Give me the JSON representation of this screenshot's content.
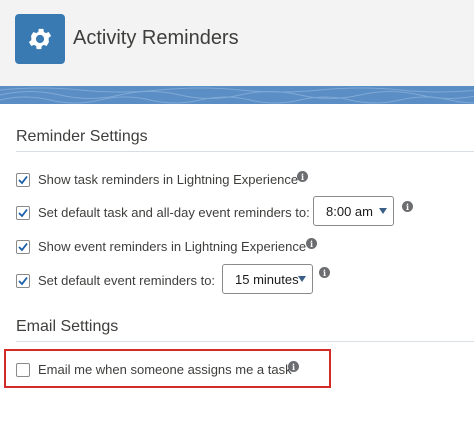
{
  "header": {
    "title": "Activity Reminders",
    "icon": "gear-icon",
    "icon_bg": "#3a7ab3"
  },
  "reminder_settings": {
    "title": "Reminder Settings",
    "items": [
      {
        "label": "Show task reminders in Lightning Experience",
        "checked": true
      },
      {
        "label": "Set default task and all-day event reminders to:",
        "checked": true,
        "select_value": "8:00 am"
      },
      {
        "label": "Show event reminders in Lightning Experience",
        "checked": true
      },
      {
        "label": "Set default event reminders to:",
        "checked": true,
        "select_value": "15 minutes"
      }
    ]
  },
  "email_settings": {
    "title": "Email Settings",
    "items": [
      {
        "label": "Email me when someone assigns me a task",
        "checked": false
      }
    ]
  },
  "colors": {
    "accent": "#3a7ab3",
    "checkmark": "#1b5fa8",
    "highlight_border": "#d42a2a"
  }
}
